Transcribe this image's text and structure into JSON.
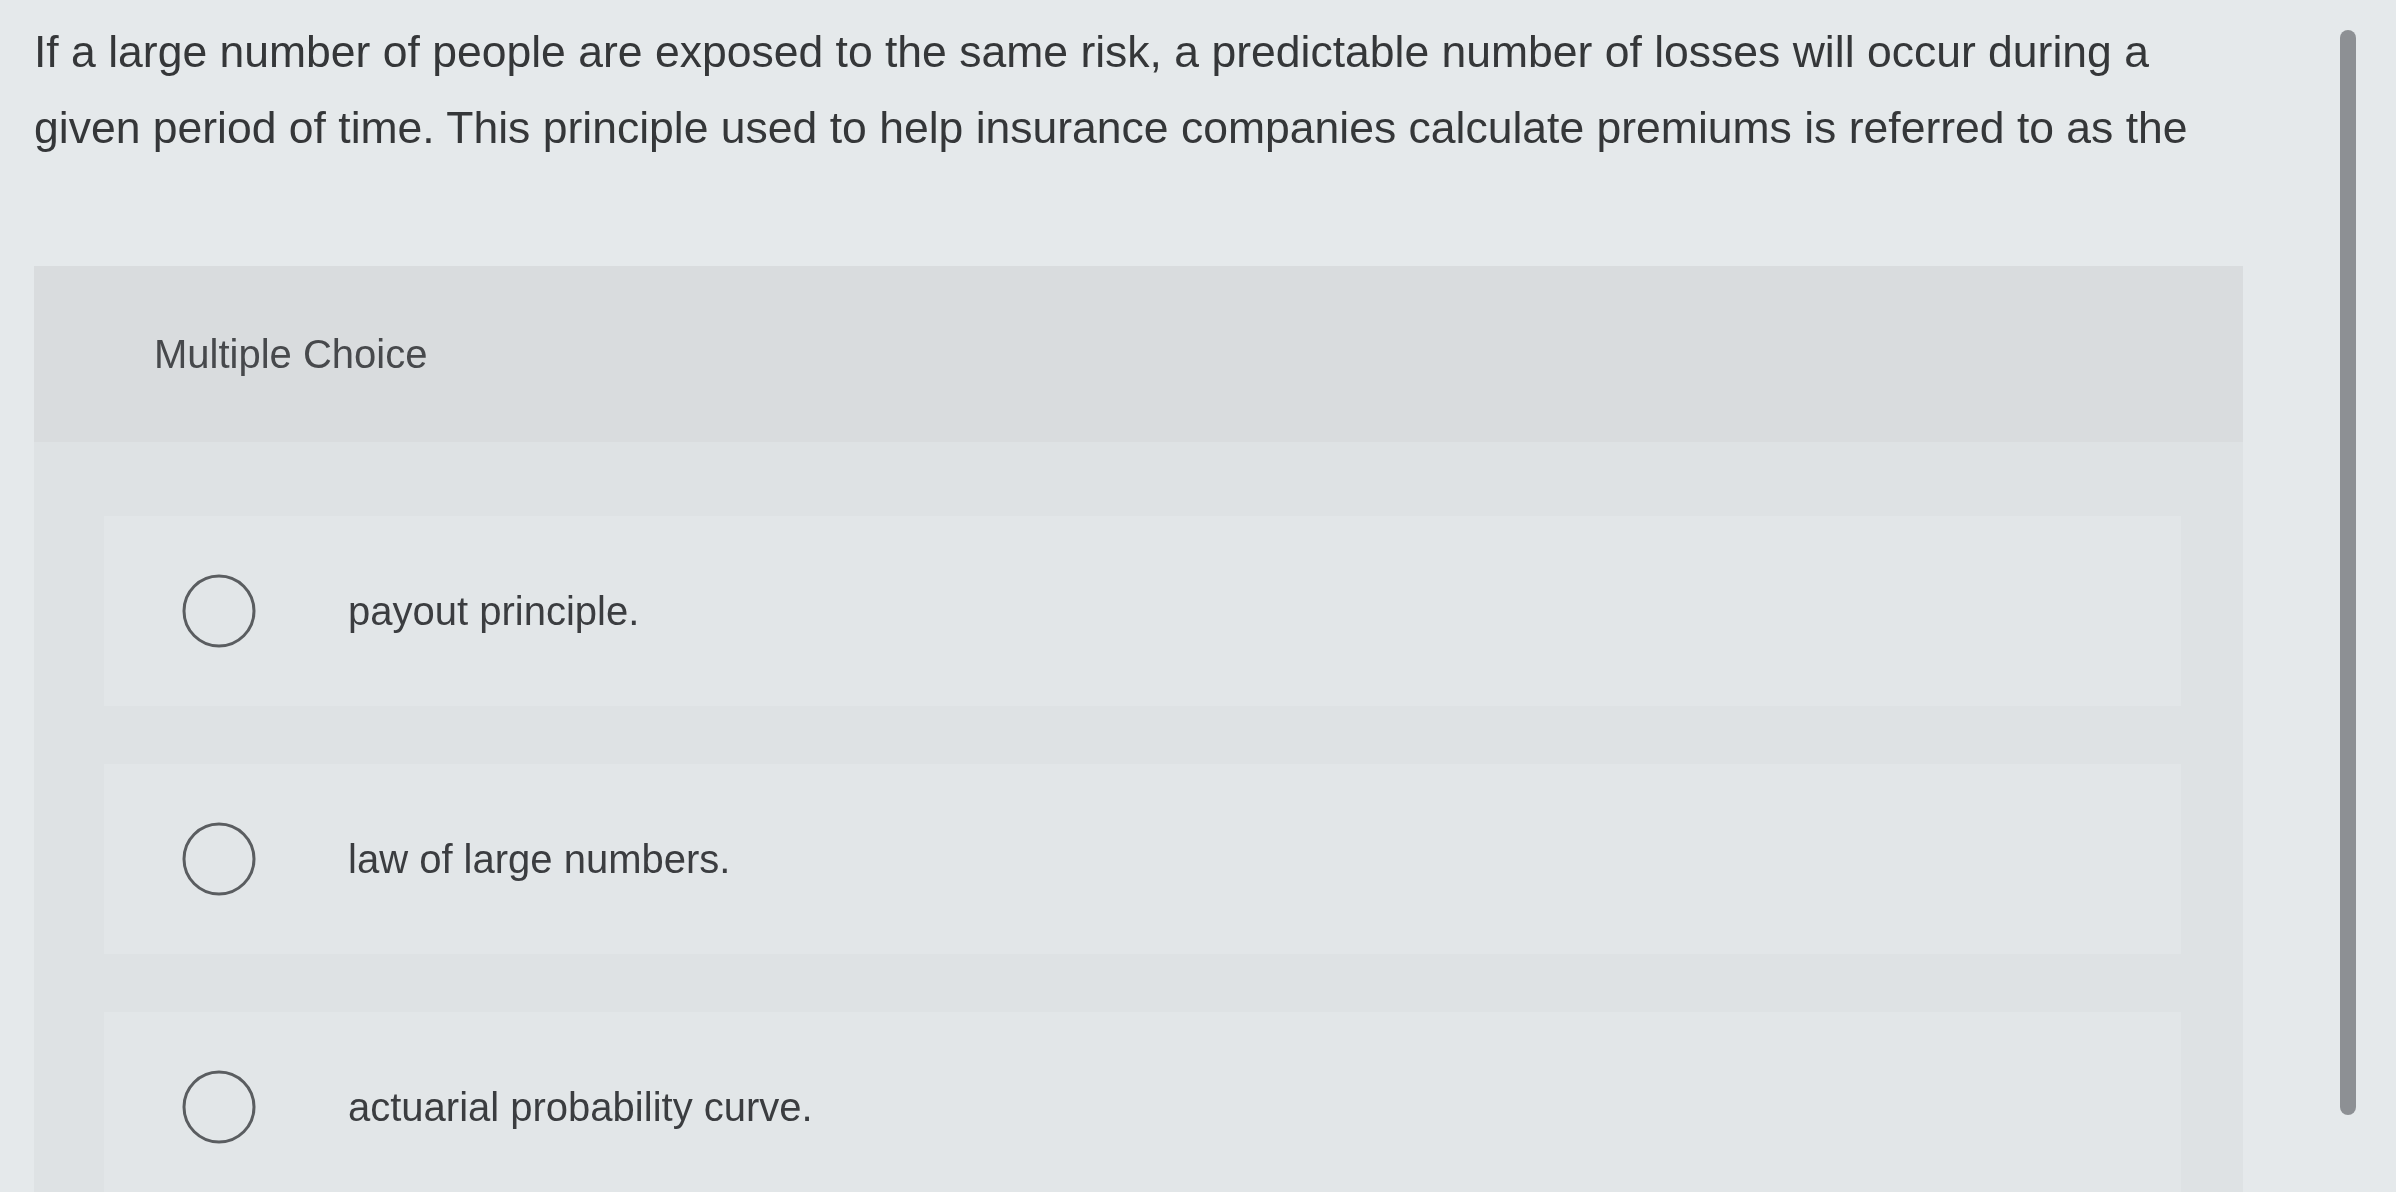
{
  "question": {
    "text": "If a large number of people are exposed to the same risk, a predictable number of losses will occur during a given period of time. This principle used to help insurance companies calculate premiums is referred to as the"
  },
  "answer_section": {
    "label": "Multiple Choice",
    "options": [
      {
        "label": "payout principle.",
        "selected": false
      },
      {
        "label": "law of large numbers.",
        "selected": false
      },
      {
        "label": "actuarial probability curve.",
        "selected": false
      }
    ]
  }
}
